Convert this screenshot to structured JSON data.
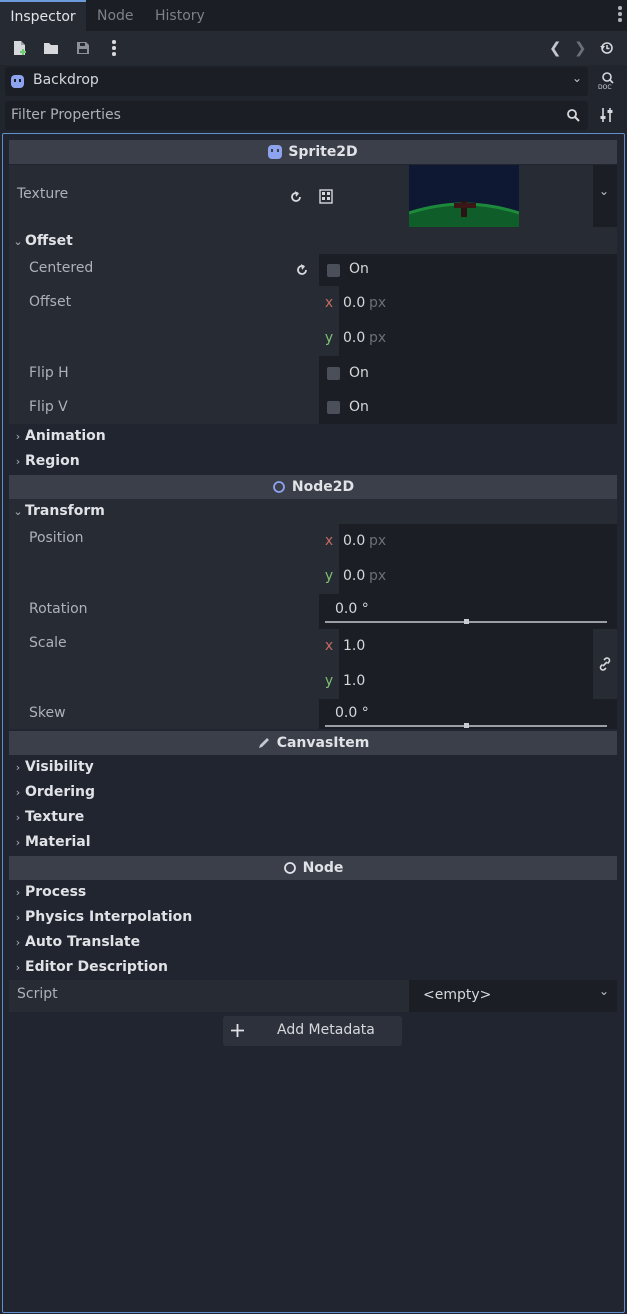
{
  "tabs": [
    "Inspector",
    "Node",
    "History"
  ],
  "object_selector": {
    "name": "Backdrop"
  },
  "filter": {
    "placeholder": "Filter Properties"
  },
  "sprite2d": {
    "header": "Sprite2D",
    "texture_label": "Texture",
    "offset_section": "Offset",
    "centered": {
      "label": "Centered",
      "value": "On"
    },
    "offset": {
      "label": "Offset",
      "x": "0.0",
      "y": "0.0",
      "unit": "px"
    },
    "flip_h": {
      "label": "Flip H",
      "value": "On"
    },
    "flip_v": {
      "label": "Flip V",
      "value": "On"
    },
    "animation_section": "Animation",
    "region_section": "Region"
  },
  "node2d": {
    "header": "Node2D",
    "transform_section": "Transform",
    "position": {
      "label": "Position",
      "x": "0.0",
      "y": "0.0",
      "unit": "px"
    },
    "rotation": {
      "label": "Rotation",
      "value": "0.0 °",
      "fraction": 0.5
    },
    "scale": {
      "label": "Scale",
      "x": "1.0",
      "y": "1.0"
    },
    "skew": {
      "label": "Skew",
      "value": "0.0 °",
      "fraction": 0.5
    }
  },
  "canvasitem": {
    "header": "CanvasItem",
    "sections": [
      "Visibility",
      "Ordering",
      "Texture",
      "Material"
    ]
  },
  "node": {
    "header": "Node",
    "sections": [
      "Process",
      "Physics Interpolation",
      "Auto Translate",
      "Editor Description"
    ],
    "script": {
      "label": "Script",
      "value": "<empty>"
    }
  },
  "add_metadata": "Add Metadata",
  "colors": {
    "accent": "#6c9bd9",
    "axis_x": "#c46a61",
    "axis_y": "#7fbf70"
  }
}
